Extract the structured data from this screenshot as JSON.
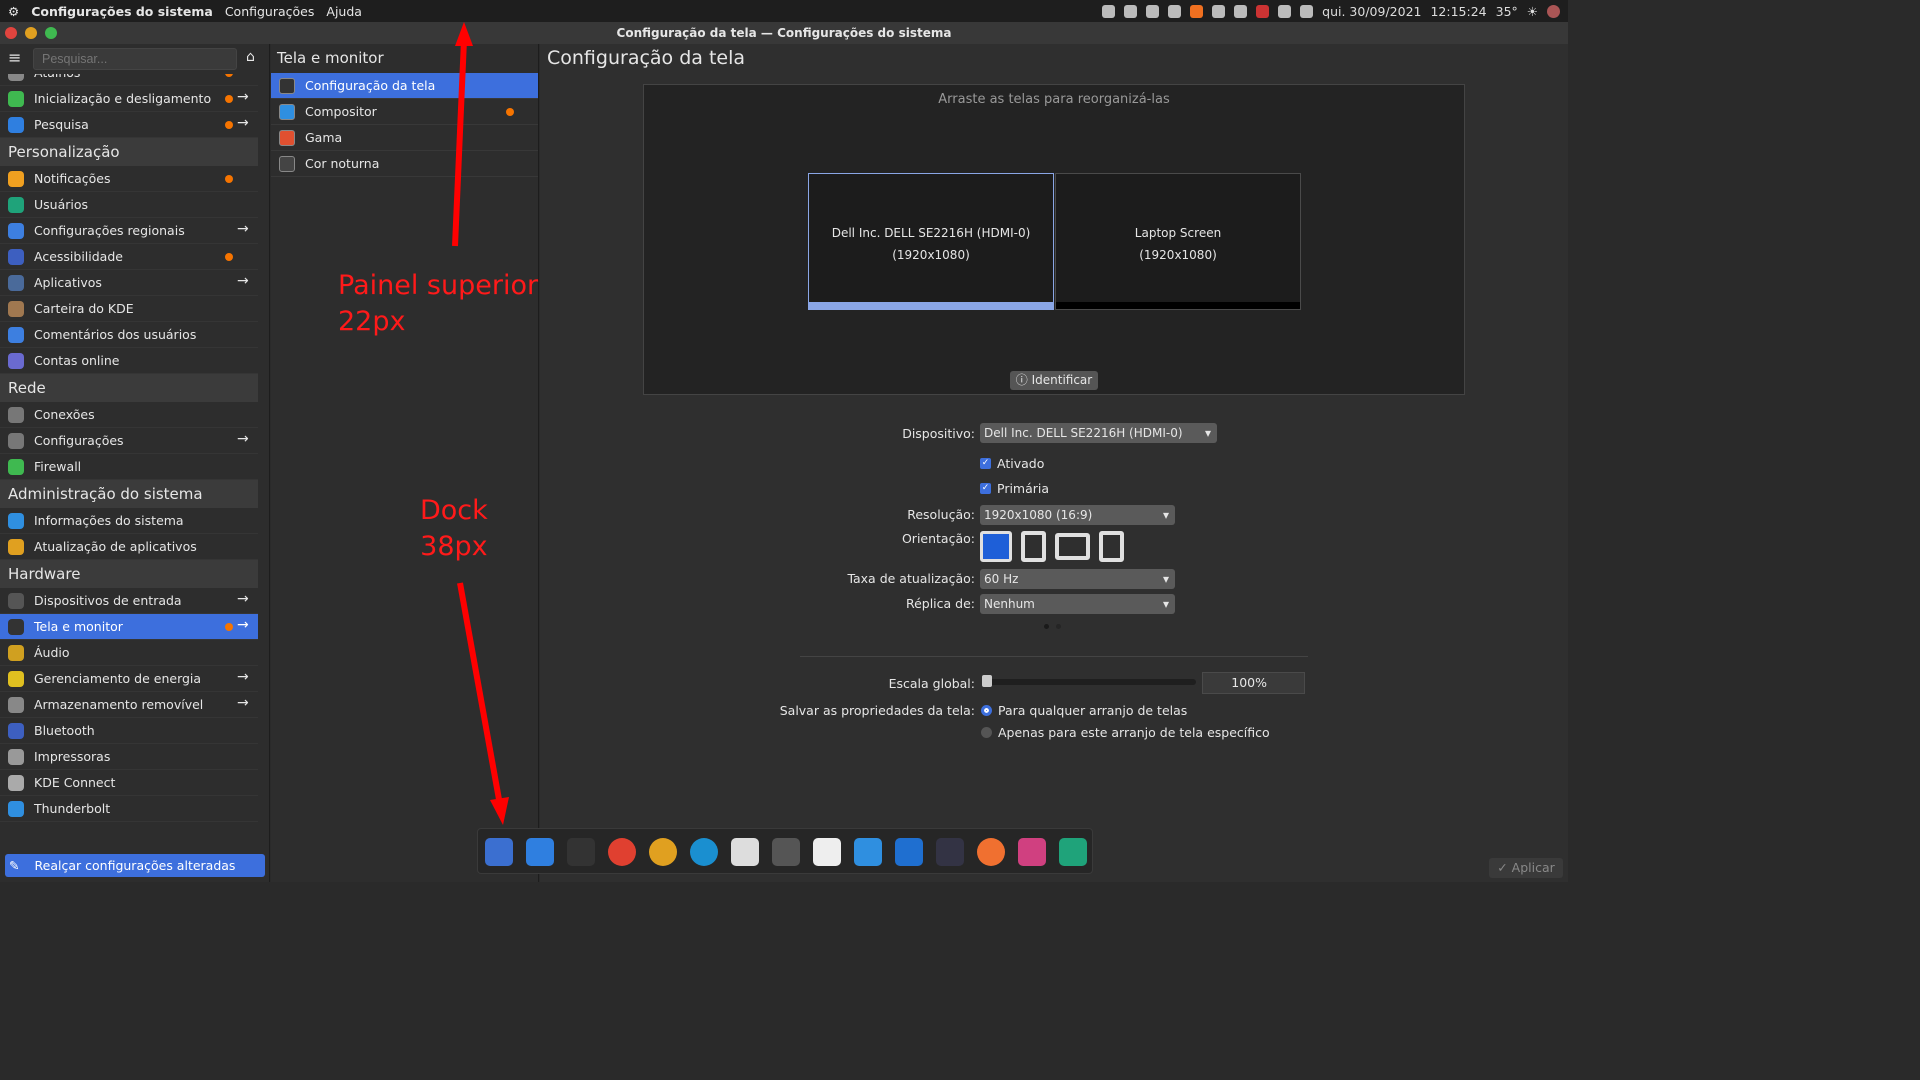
{
  "topbar": {
    "app": "Configurações do sistema",
    "menus": [
      "Configurações",
      "Ajuda"
    ],
    "date": "qui. 30/09/2021",
    "time": "12:15:24",
    "temp": "35°"
  },
  "window": {
    "title": "Configuração da tela — Configurações do sistema"
  },
  "sidebar": {
    "search_placeholder": "Pesquisar...",
    "highlight_button": "Realçar configurações alteradas",
    "items": [
      {
        "type": "item",
        "label": "Atalhos",
        "dot": true,
        "arrow": true,
        "color": "#888"
      },
      {
        "type": "item",
        "label": "Inicialização e desligamento",
        "dot": true,
        "arrow": true,
        "color": "#3fb950"
      },
      {
        "type": "item",
        "label": "Pesquisa",
        "dot": true,
        "arrow": true,
        "color": "#2f7fe0"
      },
      {
        "type": "header",
        "label": "Personalização"
      },
      {
        "type": "item",
        "label": "Notificações",
        "dot": true,
        "color": "#f0a020"
      },
      {
        "type": "item",
        "label": "Usuários",
        "color": "#1fa37a"
      },
      {
        "type": "item",
        "label": "Configurações regionais",
        "arrow": true,
        "color": "#3d7fe0"
      },
      {
        "type": "item",
        "label": "Acessibilidade",
        "dot": true,
        "color": "#3d5fc0"
      },
      {
        "type": "item",
        "label": "Aplicativos",
        "arrow": true,
        "color": "#4a6a9a"
      },
      {
        "type": "item",
        "label": "Carteira do KDE",
        "color": "#a07850"
      },
      {
        "type": "item",
        "label": "Comentários dos usuários",
        "color": "#3d7fe0"
      },
      {
        "type": "item",
        "label": "Contas online",
        "color": "#6a6ad0"
      },
      {
        "type": "header",
        "label": "Rede"
      },
      {
        "type": "item",
        "label": "Conexões",
        "color": "#777"
      },
      {
        "type": "item",
        "label": "Configurações",
        "arrow": true,
        "color": "#777"
      },
      {
        "type": "item",
        "label": "Firewall",
        "color": "#3fb950"
      },
      {
        "type": "header",
        "label": "Administração do sistema"
      },
      {
        "type": "item",
        "label": "Informações do sistema",
        "color": "#2f8fe0"
      },
      {
        "type": "item",
        "label": "Atualização de aplicativos",
        "color": "#e0a020"
      },
      {
        "type": "header",
        "label": "Hardware"
      },
      {
        "type": "item",
        "label": "Dispositivos de entrada",
        "arrow": true,
        "color": "#555"
      },
      {
        "type": "item",
        "label": "Tela e monitor",
        "dot": true,
        "arrow": true,
        "selected": true,
        "color": "#333"
      },
      {
        "type": "item",
        "label": "Áudio",
        "color": "#d0a020"
      },
      {
        "type": "item",
        "label": "Gerenciamento de energia",
        "arrow": true,
        "color": "#e0c020"
      },
      {
        "type": "item",
        "label": "Armazenamento removível",
        "arrow": true,
        "color": "#888"
      },
      {
        "type": "item",
        "label": "Bluetooth",
        "color": "#3d5fc0"
      },
      {
        "type": "item",
        "label": "Impressoras",
        "color": "#999"
      },
      {
        "type": "item",
        "label": "KDE Connect",
        "color": "#aaa"
      },
      {
        "type": "item",
        "label": "Thunderbolt",
        "color": "#2f8fe0"
      }
    ]
  },
  "middle": {
    "title": "Tela e monitor",
    "items": [
      {
        "label": "Configuração da tela",
        "selected": true,
        "color": "#333"
      },
      {
        "label": "Compositor",
        "dot": true,
        "color": "#2f8fe0"
      },
      {
        "label": "Gama",
        "color": "#e05030"
      },
      {
        "label": "Cor noturna",
        "color": "#444"
      }
    ]
  },
  "main": {
    "title": "Configuração da tela",
    "arrange_hint": "Arraste as telas para reorganizá-las",
    "monitors": [
      {
        "name": "Dell Inc. DELL SE2216H (HDMI-0)",
        "res": "(1920x1080)"
      },
      {
        "name": "Laptop Screen",
        "res": "(1920x1080)"
      }
    ],
    "identify": "Identificar",
    "device_label": "Dispositivo:",
    "device": "Dell Inc. DELL SE2216H (HDMI-0)",
    "enabled": "Ativado",
    "primary": "Primária",
    "resolution_label": "Resolução:",
    "resolution": "1920x1080 (16:9)",
    "orientation_label": "Orientação:",
    "refresh_label": "Taxa de atualização:",
    "refresh": "60 Hz",
    "replica_label": "Réplica de:",
    "replica": "Nenhum",
    "scale_label": "Escala global:",
    "scale": "100%",
    "scale_value": 100,
    "save_label": "Salvar as propriedades da tela:",
    "save_opt1": "Para qualquer arranjo de telas",
    "save_opt2": "Apenas para este arranjo de tela específico",
    "apply": "Aplicar"
  },
  "annotations": {
    "panel": [
      "Painel superior",
      "22px"
    ],
    "dock": [
      "Dock",
      "38px"
    ]
  },
  "accent": "#3d6fdd",
  "dock": {
    "icons": [
      "overview-icon",
      "files-icon",
      "terminal-icon",
      "chrome-icon",
      "chrome-icon",
      "teamviewer-icon",
      "vim-icon",
      "calculator-icon",
      "notes-icon",
      "vscode-icon",
      "vscode-insiders-icon",
      "mysql-workbench-icon",
      "postman-icon",
      "store-icon",
      "system-settings-icon"
    ]
  }
}
